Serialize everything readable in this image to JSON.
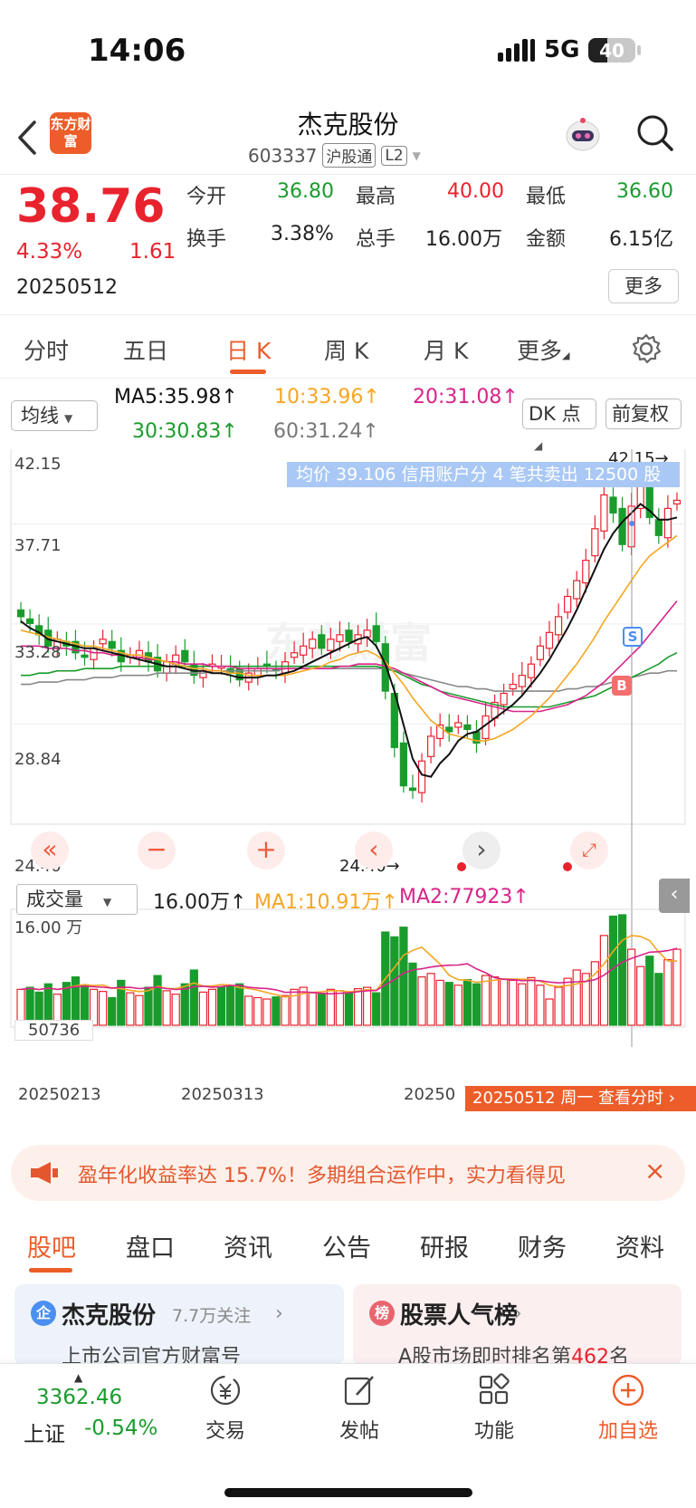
{
  "status": {
    "time": "14:06",
    "network": "5G",
    "battery": "40",
    "battery_level": 0.4
  },
  "header": {
    "logo": "东方财富",
    "stock_name": "杰克股份",
    "code": "603337",
    "tag1": "沪股通",
    "tag2": "L2"
  },
  "quote": {
    "price": "38.76",
    "change_pct": "4.33%",
    "change": "1.61",
    "date": "20250512",
    "open_label": "今开",
    "open": "36.80",
    "high_label": "最高",
    "high": "40.00",
    "low_label": "最低",
    "low": "36.60",
    "turnover_label": "换手",
    "turnover": "3.38%",
    "volume_label": "总手",
    "volume": "16.00万",
    "amount_label": "金额",
    "amount": "6.15亿",
    "more": "更多"
  },
  "tabs": [
    "分时",
    "五日",
    "日 K",
    "周 K",
    "月 K",
    "更多"
  ],
  "ma": {
    "select": "均线",
    "ma5": "MA5:35.98↑",
    "ma10": "10:33.96↑",
    "ma20": "20:31.08↑",
    "ma30": "30:30.83↑",
    "ma60": "60:31.24↑",
    "dk": "DK 点",
    "fq": "前复权"
  },
  "chart_data": {
    "type": "candlestick",
    "y_ticks": [
      "42.15",
      "37.71",
      "33.28",
      "28.84",
      "24.40"
    ],
    "ylim": [
      24.4,
      42.15
    ],
    "high_label": "42.15→",
    "low_label": "24.40→",
    "tooltip": "均价 39.106 信用账户分 4 笔共卖出 12500 股",
    "marker_s": "S",
    "marker_b": "B",
    "closes": [
      33.6,
      33.3,
      32.8,
      32.3,
      32.6,
      32.3,
      32.0,
      31.8,
      32.2,
      32.6,
      32.2,
      31.6,
      31.9,
      32.1,
      31.6,
      31.2,
      31.6,
      31.9,
      31.6,
      31.0,
      31.2,
      31.5,
      31.4,
      31.1,
      30.8,
      31.1,
      31.3,
      31.4,
      31.2,
      31.6,
      32.0,
      32.3,
      32.6,
      32.2,
      32.6,
      32.8,
      32.5,
      32.8,
      33.0,
      32.5,
      30.3,
      27.8,
      26.1,
      25.9,
      27.2,
      28.3,
      28.8,
      28.5,
      28.9,
      28.6,
      28.0,
      29.2,
      29.8,
      30.2,
      30.6,
      31.0,
      31.5,
      32.3,
      32.9,
      33.6,
      34.5,
      35.2,
      36.1,
      37.5,
      39.0,
      38.2,
      36.8,
      38.5,
      39.5,
      38.0,
      37.2,
      38.4,
      38.76
    ],
    "ma5": [
      33.4,
      33.1,
      32.9,
      32.6,
      32.5,
      32.4,
      32.3,
      32.2,
      32.2,
      32.1,
      32.0,
      31.9,
      31.8,
      31.7,
      31.6,
      31.5,
      31.4,
      31.4,
      31.3,
      31.2,
      31.2,
      31.1,
      31.1,
      31.0,
      30.9,
      30.9,
      30.9,
      31.0,
      31.0,
      31.1,
      31.2,
      31.4,
      31.6,
      31.8,
      32.0,
      32.2,
      32.4,
      32.6,
      32.7,
      32.3,
      31.5,
      30.3,
      28.8,
      27.3,
      26.6,
      26.5,
      27.1,
      27.5,
      28.1,
      28.4,
      28.5,
      28.8,
      29.1,
      29.4,
      29.7,
      30.1,
      30.6,
      31.1,
      31.7,
      32.4,
      33.1,
      33.9,
      34.8,
      35.7,
      36.6,
      37.3,
      37.8,
      38.2,
      38.6,
      38.3,
      37.9,
      37.9,
      38.0
    ],
    "ma10": [
      33.0,
      32.9,
      32.8,
      32.7,
      32.6,
      32.5,
      32.4,
      32.3,
      32.3,
      32.2,
      32.1,
      32.0,
      31.9,
      31.9,
      31.8,
      31.7,
      31.6,
      31.5,
      31.4,
      31.3,
      31.3,
      31.2,
      31.2,
      31.1,
      31.1,
      31.0,
      31.0,
      31.0,
      31.0,
      31.0,
      31.1,
      31.2,
      31.3,
      31.4,
      31.6,
      31.7,
      31.9,
      32.0,
      32.1,
      31.9,
      31.6,
      31.1,
      30.6,
      30.0,
      29.5,
      29.0,
      28.7,
      28.4,
      28.3,
      28.2,
      28.1,
      28.1,
      28.2,
      28.4,
      28.6,
      28.9,
      29.2,
      29.6,
      30.0,
      30.5,
      31.0,
      31.5,
      32.1,
      32.7,
      33.4,
      34.0,
      34.6,
      35.2,
      35.8,
      36.3,
      36.6,
      36.9,
      37.2
    ],
    "ma20": [
      32.3,
      32.3,
      32.3,
      32.2,
      32.2,
      32.2,
      32.1,
      32.1,
      32.0,
      32.0,
      31.9,
      31.9,
      31.8,
      31.8,
      31.7,
      31.7,
      31.6,
      31.6,
      31.5,
      31.5,
      31.5,
      31.4,
      31.4,
      31.4,
      31.3,
      31.3,
      31.3,
      31.3,
      31.3,
      31.3,
      31.3,
      31.3,
      31.3,
      31.3,
      31.3,
      31.4,
      31.4,
      31.5,
      31.5,
      31.5,
      31.4,
      31.3,
      31.1,
      30.9,
      30.7,
      30.5,
      30.3,
      30.1,
      30.0,
      29.9,
      29.8,
      29.7,
      29.6,
      29.5,
      29.4,
      29.4,
      29.4,
      29.4,
      29.5,
      29.6,
      29.7,
      29.9,
      30.1,
      30.4,
      30.7,
      31.1,
      31.5,
      31.9,
      32.3,
      32.8,
      33.3,
      33.8,
      34.3
    ],
    "ma30": [
      31.0,
      31.0,
      31.1,
      31.1,
      31.2,
      31.2,
      31.2,
      31.3,
      31.3,
      31.3,
      31.3,
      31.4,
      31.4,
      31.4,
      31.4,
      31.4,
      31.4,
      31.4,
      31.4,
      31.4,
      31.4,
      31.4,
      31.4,
      31.4,
      31.4,
      31.4,
      31.4,
      31.4,
      31.4,
      31.4,
      31.4,
      31.4,
      31.4,
      31.4,
      31.4,
      31.4,
      31.4,
      31.4,
      31.4,
      31.4,
      31.3,
      31.2,
      31.0,
      30.8,
      30.6,
      30.5,
      30.3,
      30.2,
      30.1,
      30.0,
      29.9,
      29.8,
      29.7,
      29.6,
      29.6,
      29.6,
      29.6,
      29.6,
      29.6,
      29.7,
      29.8,
      29.9,
      30.0,
      30.1,
      30.3,
      30.5,
      30.7,
      30.9,
      31.1,
      31.3,
      31.5,
      31.8,
      32.0
    ],
    "ma60": [
      30.6,
      30.6,
      30.7,
      30.7,
      30.7,
      30.8,
      30.8,
      30.8,
      30.9,
      30.9,
      30.9,
      31.0,
      31.0,
      31.0,
      31.0,
      31.1,
      31.1,
      31.1,
      31.1,
      31.1,
      31.1,
      31.2,
      31.2,
      31.2,
      31.2,
      31.2,
      31.2,
      31.2,
      31.2,
      31.3,
      31.3,
      31.3,
      31.3,
      31.3,
      31.3,
      31.3,
      31.3,
      31.3,
      31.3,
      31.3,
      31.3,
      31.2,
      31.1,
      31.0,
      30.9,
      30.8,
      30.7,
      30.6,
      30.5,
      30.5,
      30.4,
      30.4,
      30.3,
      30.3,
      30.3,
      30.3,
      30.3,
      30.3,
      30.3,
      30.3,
      30.4,
      30.4,
      30.5,
      30.5,
      30.6,
      30.7,
      30.8,
      30.9,
      31.0,
      31.1,
      31.1,
      31.2,
      31.2
    ],
    "volume_select": "成交量",
    "volume_value": "16.00万↑",
    "vol_ma1": "MA1:10.91万↑",
    "vol_ma2": "MA2:77923↑",
    "vol_y_ticks": [
      "16.00 万",
      "50736"
    ],
    "vol_ylim": [
      0,
      160000
    ],
    "volumes": [
      52000,
      55000,
      48000,
      60000,
      45000,
      62000,
      70000,
      58000,
      52000,
      49000,
      40000,
      65000,
      47000,
      43000,
      55000,
      72000,
      50000,
      45000,
      60000,
      80000,
      48000,
      52000,
      55000,
      57000,
      60000,
      42000,
      40000,
      38000,
      41000,
      43000,
      52000,
      55000,
      47000,
      45000,
      52000,
      50000,
      48000,
      53000,
      55000,
      47000,
      135000,
      128000,
      142000,
      90000,
      70000,
      75000,
      65000,
      62000,
      58000,
      66000,
      60000,
      72000,
      70000,
      67000,
      65000,
      60000,
      69000,
      58000,
      38000,
      55000,
      68000,
      80000,
      75000,
      92000,
      130000,
      158000,
      160000,
      110000,
      85000,
      100000,
      75000,
      95000,
      110000
    ],
    "x_labels": [
      "20250213",
      "20250313",
      "20250"
    ],
    "date_tip": "20250512 周一 查看分时"
  },
  "banner": {
    "text": "盈年化收益率达 15.7%！多期组合运作中，实力看得见"
  },
  "section_tabs": [
    "股吧",
    "盘口",
    "资讯",
    "公告",
    "研报",
    "财务",
    "资料"
  ],
  "cards": [
    {
      "icon": "企",
      "title": "杰克股份",
      "meta": "7.7万关注",
      "desc": "上市公司官方财富号"
    },
    {
      "icon": "榜",
      "title": "股票人气榜",
      "meta": "",
      "desc_prefix": "A股市场即时排名第",
      "rank": "462",
      "desc_suffix": "名"
    }
  ],
  "bottom": {
    "index_value": "3362.46",
    "index_name": "上证",
    "index_change": "-0.54%",
    "trade": "交易",
    "post": "发帖",
    "func": "功能",
    "add": "加自选"
  },
  "colors": {
    "up": "#e8232e",
    "down": "#1a9c2d",
    "accent": "#ec5d2a",
    "ma5": "#111111",
    "ma10": "#f5a623",
    "ma20": "#d8248a",
    "ma30": "#1a9c2d",
    "ma60": "#888888"
  }
}
